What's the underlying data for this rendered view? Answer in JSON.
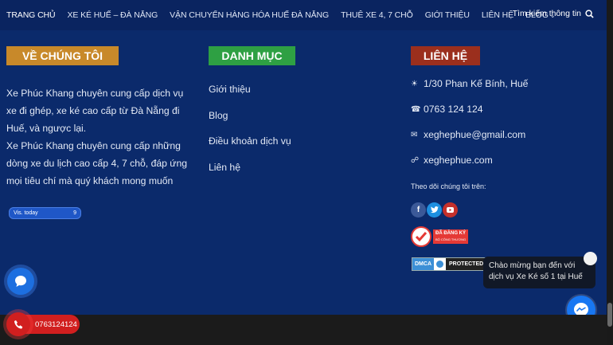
{
  "nav": {
    "items": [
      {
        "label": "TRANG CHỦ"
      },
      {
        "label": "XE KÉ HUẾ – ĐÀ NẴNG"
      },
      {
        "label": "VẬN CHUYỂN HÀNG HÓA HUẾ ĐÀ NẴNG"
      },
      {
        "label": "THUÊ XE 4, 7 CHỖ"
      },
      {
        "label": "GIỚI THIỆU"
      },
      {
        "label": "LIÊN HỆ"
      },
      {
        "label": "BLOG"
      }
    ],
    "search_label": "Tìm kiếm thông tin"
  },
  "about": {
    "heading": "VỀ CHÚNG TÔI",
    "text1": "Xe Phúc Khang chuyên cung cấp dịch vụ xe đi ghép, xe ké cao cấp từ Đà Nẵng đi Huế, và ngược lại.",
    "text2": "Xe Phúc Khang chuyên cung cấp những dòng xe du lịch cao cấp 4, 7 chỗ, đáp ứng mọi tiêu chí mà quý khách mong muốn"
  },
  "visits": {
    "label": "Vis. today",
    "count": "9"
  },
  "categories": {
    "heading": "DANH MỤC",
    "items": [
      "Giới thiệu",
      "Blog",
      "Điều khoản dịch vụ",
      "Liên hệ"
    ]
  },
  "contact": {
    "heading": "LIÊN HỆ",
    "address": "1/30 Phan Kế Bính, Huế",
    "phone": "0763 124 124",
    "email": "xeghephue@gmail.com",
    "website": "xeghephue.com",
    "follow": "Theo dõi chúng tôi trên:"
  },
  "badges": {
    "registered": "ĐÃ ĐĂNG KÝ",
    "registered_sub": "BỘ CÔNG THƯƠNG",
    "dmca_left": "DMCA",
    "dmca_right": "PROTECTED"
  },
  "chat": {
    "tooltip": "Chào mừng bạn đến với dịch vụ Xe Ké số 1 tại Huế"
  },
  "call": {
    "number": "0763124124"
  },
  "colors": {
    "background": "#0b2a6b",
    "about_heading": "#c8892a",
    "category_heading": "#2ea043",
    "contact_heading": "#9b2f1d",
    "call_button": "#d11f1f",
    "messenger": "#1877f2"
  },
  "icons": {
    "search": "search-icon",
    "address": "sun-icon",
    "phone": "phone-icon",
    "email": "email-icon",
    "website": "link-icon"
  }
}
